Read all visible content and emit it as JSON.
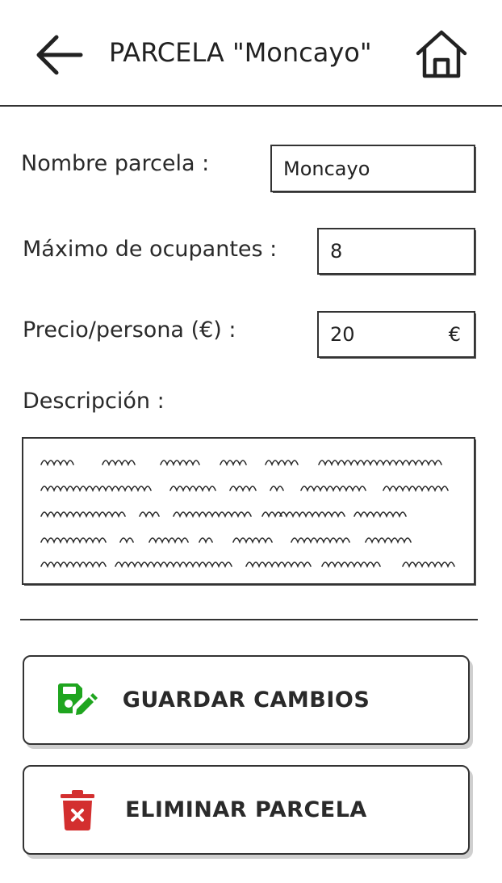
{
  "header": {
    "title": "PARCELA \"Moncayo\"",
    "back_icon": "arrow-left-icon",
    "home_icon": "home-icon"
  },
  "form": {
    "nombre": {
      "label": "Nombre parcela :",
      "value": "Moncayo"
    },
    "maximo": {
      "label": "Máximo de ocupantes :",
      "value": "8"
    },
    "precio": {
      "label": "Precio/persona (€) :",
      "value": "20",
      "unit": "€"
    },
    "descripcion": {
      "label": "Descripción :"
    }
  },
  "actions": {
    "save": {
      "label": "GUARDAR CAMBIOS",
      "icon": "save-edit-icon",
      "color": "#1fa51f"
    },
    "delete": {
      "label": "ELIMINAR PARCELA",
      "icon": "trash-icon",
      "color": "#d32f2f"
    }
  }
}
